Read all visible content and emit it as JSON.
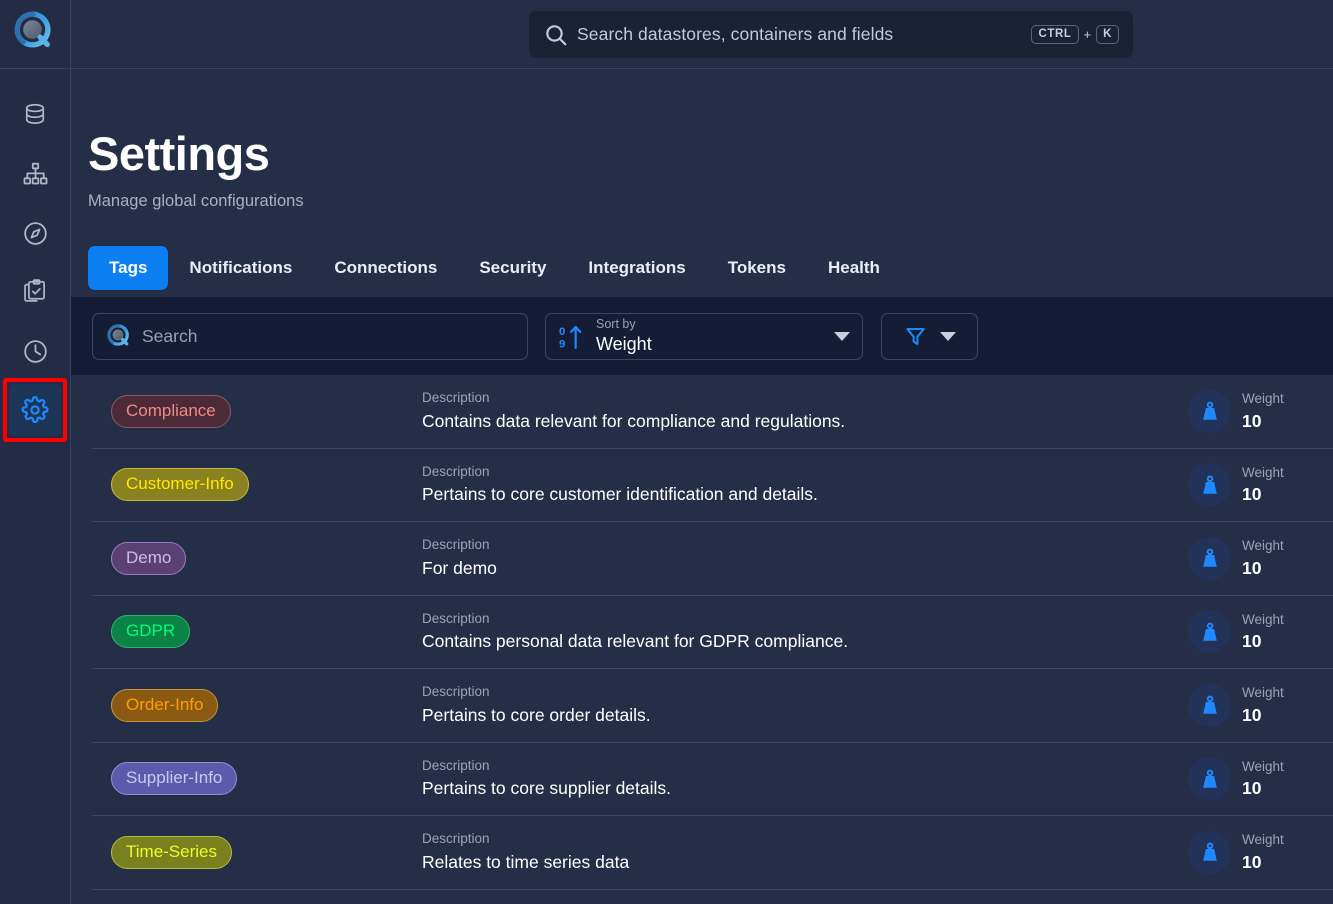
{
  "app": {
    "logo_icon": "magnifier-logo-icon"
  },
  "topbar": {
    "search": {
      "placeholder": "Search datastores, containers and fields",
      "icon": "search-icon",
      "shortcut_modifier": "CTRL",
      "shortcut_plus": "+",
      "shortcut_key": "K"
    }
  },
  "sidebar": {
    "items": [
      {
        "name": "datastores",
        "icon": "database-icon",
        "active": false,
        "annotated": false
      },
      {
        "name": "hierarchy",
        "icon": "sitemap-icon",
        "active": false,
        "annotated": false
      },
      {
        "name": "explore",
        "icon": "compass-icon",
        "active": false,
        "annotated": false
      },
      {
        "name": "assessments",
        "icon": "clipboard-check-icon",
        "active": false,
        "annotated": false
      },
      {
        "name": "history",
        "icon": "clock-icon",
        "active": false,
        "annotated": false
      },
      {
        "name": "settings",
        "icon": "gear-icon",
        "active": true,
        "annotated": true
      }
    ]
  },
  "page": {
    "title": "Settings",
    "subtitle": "Manage global configurations"
  },
  "tabs": [
    {
      "label": "Tags",
      "active": true
    },
    {
      "label": "Notifications",
      "active": false
    },
    {
      "label": "Connections",
      "active": false
    },
    {
      "label": "Security",
      "active": false
    },
    {
      "label": "Integrations",
      "active": false
    },
    {
      "label": "Tokens",
      "active": false
    },
    {
      "label": "Health",
      "active": false
    }
  ],
  "toolbar": {
    "search_placeholder": "Search",
    "search_icon": "search-icon",
    "sort": {
      "icon": "sort-numeric-ascending-icon",
      "label": "Sort by",
      "value": "Weight",
      "caret_icon": "chevron-down-icon"
    },
    "filter": {
      "icon": "funnel-icon",
      "caret_icon": "chevron-down-icon"
    }
  },
  "list": {
    "description_label": "Description",
    "weight_label": "Weight",
    "weight_icon": "weight-icon",
    "rows": [
      {
        "tag": "Compliance",
        "tag_bg": "#4c2a38",
        "tag_border": "#8e5866",
        "tag_color": "#f08a85",
        "description": "Contains data relevant for compliance and regulations.",
        "weight": "10"
      },
      {
        "tag": "Customer-Info",
        "tag_bg": "#8a8120",
        "tag_border": "#c6b93a",
        "tag_color": "#ffe800",
        "description": "Pertains to core customer identification and details.",
        "weight": "10"
      },
      {
        "tag": "Demo",
        "tag_bg": "#5b4073",
        "tag_border": "#9b7cc4",
        "tag_color": "#cbb9ef",
        "description": "For demo",
        "weight": "10"
      },
      {
        "tag": "GDPR",
        "tag_bg": "#0b8347",
        "tag_border": "#29b46d",
        "tag_color": "#00ff7a",
        "description": "Contains personal data relevant for GDPR compliance.",
        "weight": "10"
      },
      {
        "tag": "Order-Info",
        "tag_bg": "#8a5a12",
        "tag_border": "#c89438",
        "tag_color": "#ff9d00",
        "description": "Pertains to core order details.",
        "weight": "10"
      },
      {
        "tag": "Supplier-Info",
        "tag_bg": "#5b5bab",
        "tag_border": "#8f8fd6",
        "tag_color": "#c9c9f5",
        "description": "Pertains to core supplier details.",
        "weight": "10"
      },
      {
        "tag": "Time-Series",
        "tag_bg": "#79801e",
        "tag_border": "#b4bd40",
        "tag_color": "#e8ff2e",
        "description": "Relates to time series data",
        "weight": "10"
      }
    ]
  },
  "colors": {
    "background": "#242e47",
    "sidebar": "#232c44",
    "toolbar_strip": "#141d35",
    "accent": "#0c7ff2",
    "divider": "#3b4564",
    "annotation": "#ff0000"
  }
}
